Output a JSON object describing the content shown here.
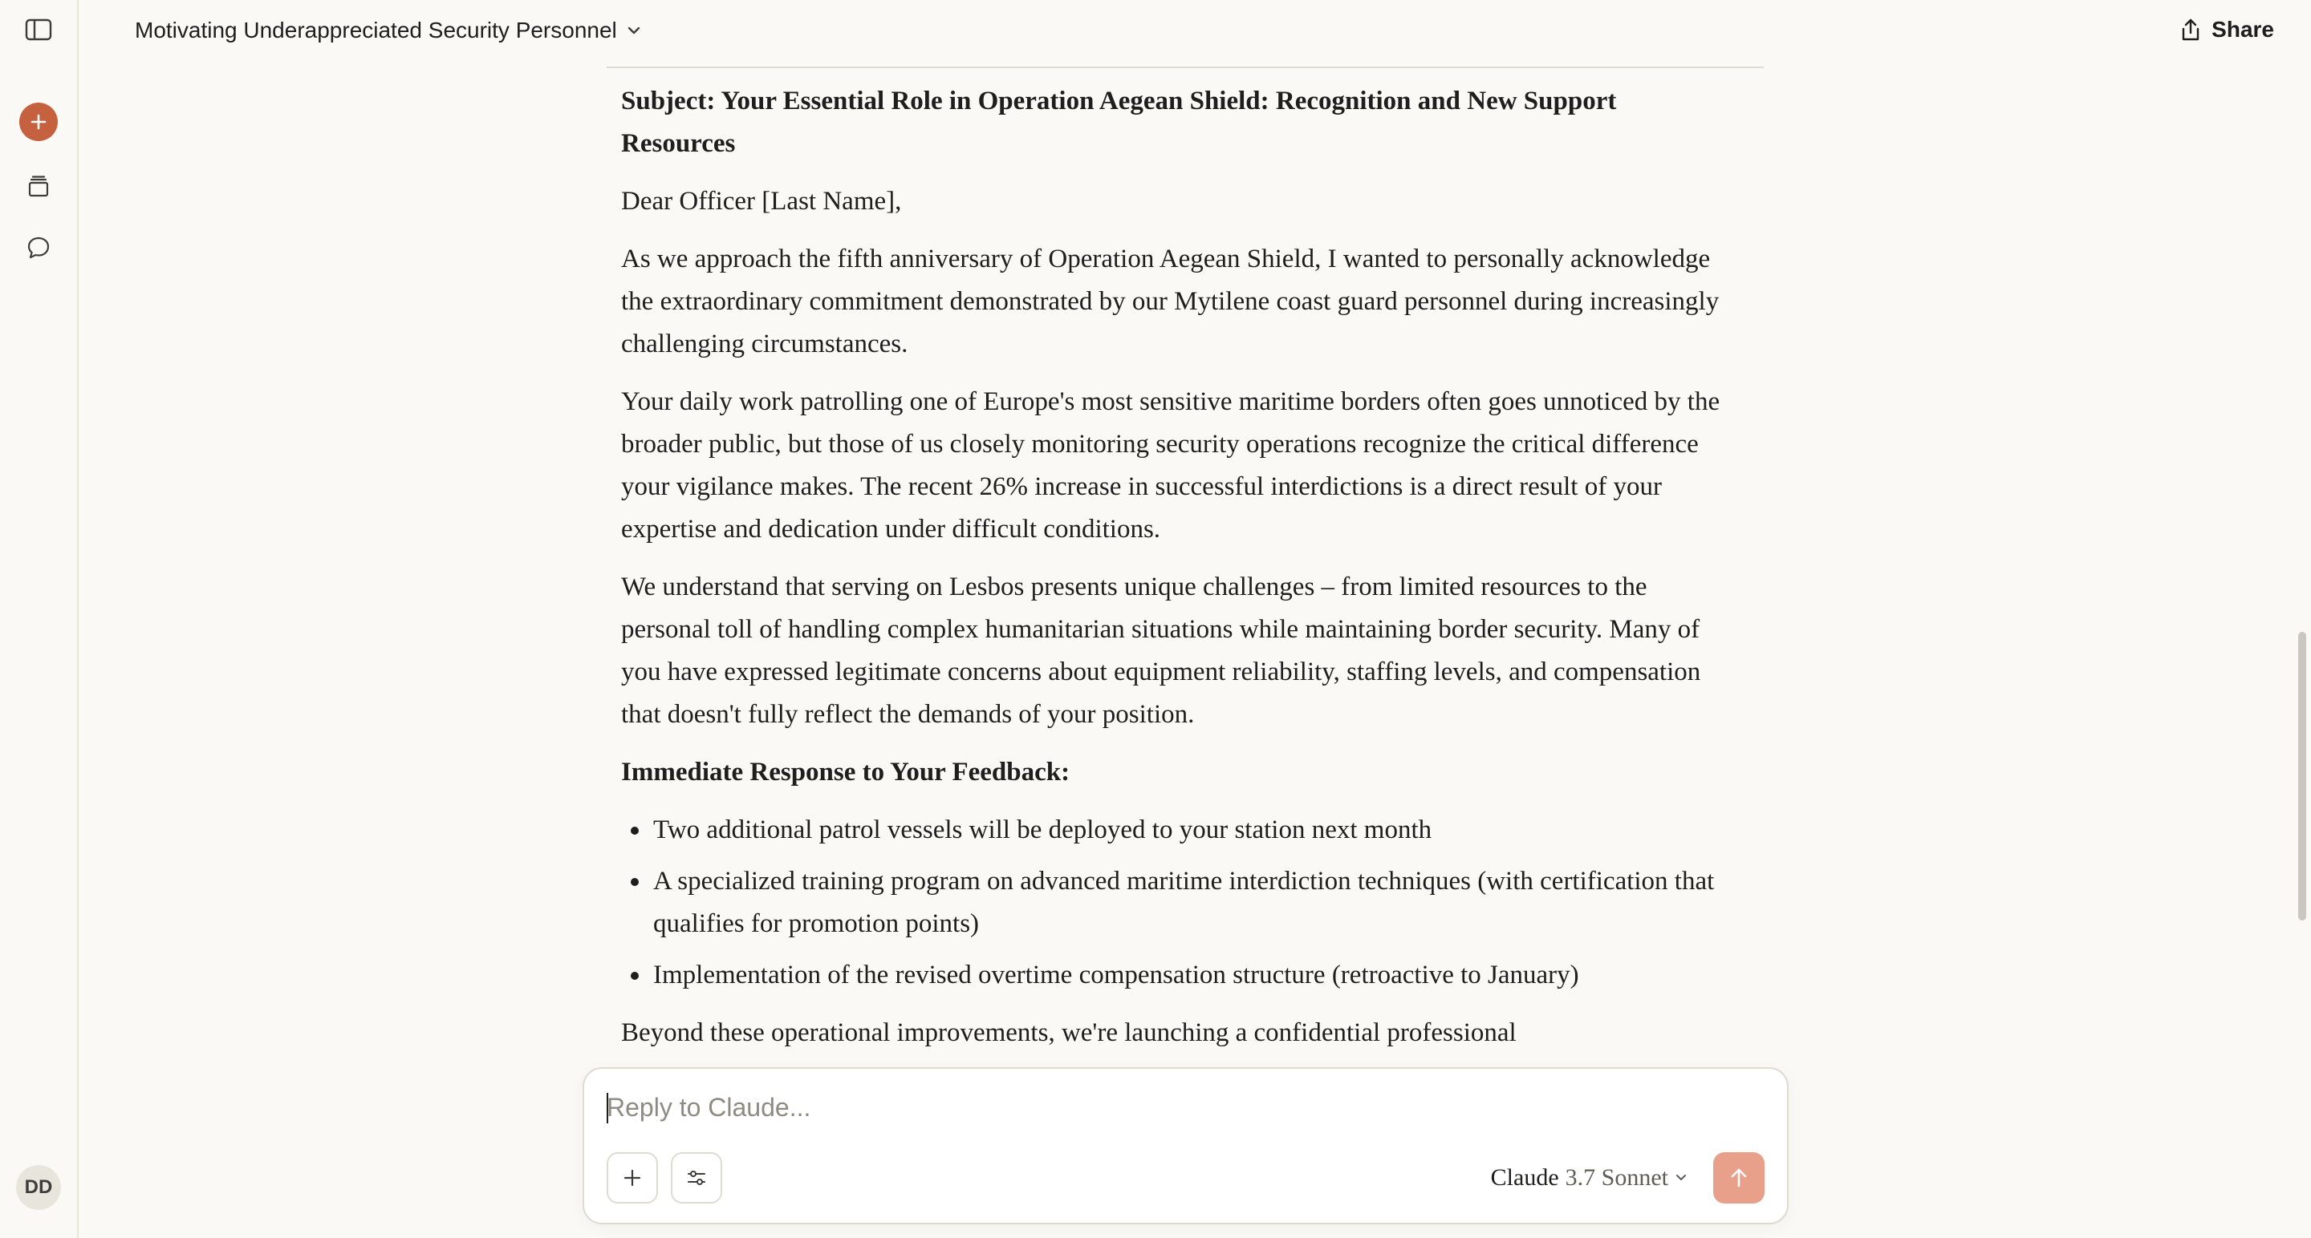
{
  "sidebar": {
    "avatar_initials": "DD",
    "icons": [
      "sidebar-toggle-icon",
      "plus-icon",
      "projects-icon",
      "chats-icon"
    ],
    "accent_color": "#c6613f"
  },
  "header": {
    "title": "Motivating Underappreciated Security Personnel",
    "share_label": "Share"
  },
  "message": {
    "subject": "Subject: Your Essential Role in Operation Aegean Shield: Recognition and New Support Resources",
    "salutation": "Dear Officer [Last Name],",
    "paragraphs": [
      "As we approach the fifth anniversary of Operation Aegean Shield, I wanted to personally acknowledge the extraordinary commitment demonstrated by our Mytilene coast guard personnel during increasingly challenging circumstances.",
      "Your daily work patrolling one of Europe's most sensitive maritime borders often goes unnoticed by the broader public, but those of us closely monitoring security operations recognize the critical difference your vigilance makes. The recent 26% increase in successful interdictions is a direct result of your expertise and dedication under difficult conditions.",
      "We understand that serving on Lesbos presents unique challenges – from limited resources to the personal toll of handling complex humanitarian situations while maintaining border security. Many of you have expressed legitimate concerns about equipment reliability, staffing levels, and compensation that doesn't fully reflect the demands of your position."
    ],
    "section_heading": "Immediate Response to Your Feedback:",
    "bullets": [
      "Two additional patrol vessels will be deployed to your station next month",
      "A specialized training program on advanced maritime interdiction techniques (with certification that qualifies for promotion points)",
      "Implementation of the revised overtime compensation structure (retroactive to January)"
    ],
    "closing_partial": "Beyond these operational improvements, we're launching a confidential professional"
  },
  "composer": {
    "placeholder": "Reply to Claude...",
    "value": "",
    "model_name": "Claude",
    "model_version": "3.7 Sonnet",
    "send_color": "#e8a08a"
  }
}
